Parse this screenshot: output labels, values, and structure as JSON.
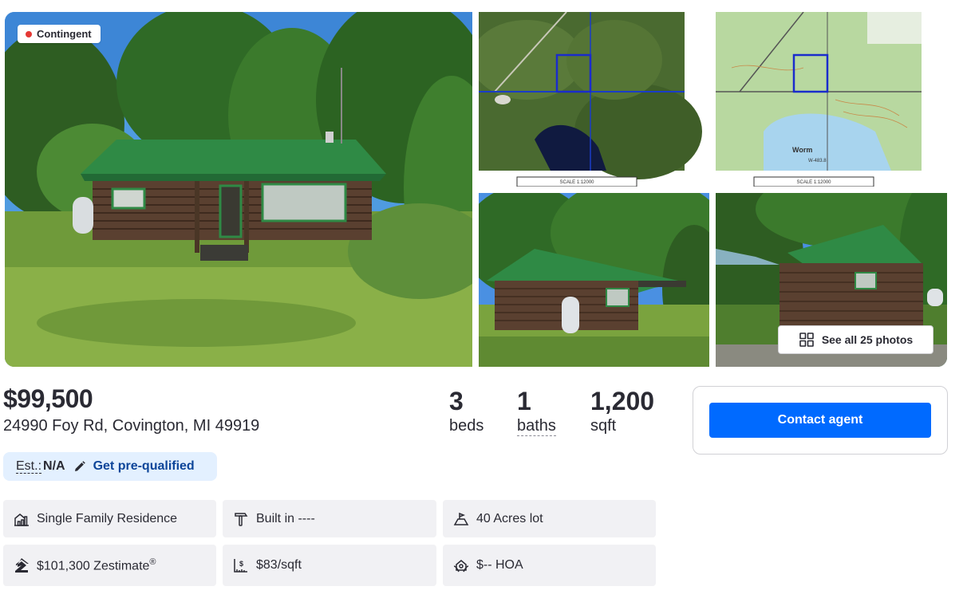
{
  "gallery": {
    "status_badge": "Contingent",
    "see_all_label": "See all 25 photos",
    "map_scale_text": "SCALE 1:12000",
    "map_lake_label": "Worm",
    "map_lake_sub": "W-483.8"
  },
  "listing": {
    "price": "$99,500",
    "address": "24990 Foy Rd, Covington, MI 49919",
    "beds_value": "3",
    "beds_label": "beds",
    "baths_value": "1",
    "baths_label": "baths",
    "sqft_value": "1,200",
    "sqft_label": "sqft"
  },
  "contact": {
    "button_label": "Contact agent"
  },
  "estimate": {
    "label": "Est.:",
    "value": "N/A",
    "link_label": "Get pre-qualified"
  },
  "facts": [
    {
      "icon": "house-chart-icon",
      "text": "Single Family Residence"
    },
    {
      "icon": "hammer-icon",
      "text": "Built in ----"
    },
    {
      "icon": "lot-size-icon",
      "text": "40 Acres lot"
    },
    {
      "icon": "zestimate-logo-icon",
      "text": "$101,300 Zestimate",
      "suffix": "®"
    },
    {
      "icon": "price-per-sqft-icon",
      "text": "$83/sqft"
    },
    {
      "icon": "hoa-icon",
      "text": "$-- HOA"
    }
  ],
  "colors": {
    "accent": "#006aff",
    "link": "#0d4599",
    "status_dot": "#e53935",
    "pill_bg": "#e3f0ff",
    "fact_bg": "#f1f1f4"
  }
}
